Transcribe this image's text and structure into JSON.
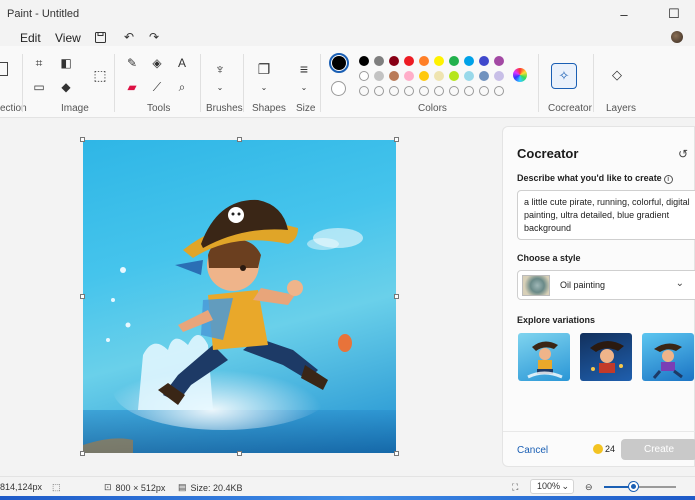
{
  "window": {
    "title": "Paint - Untitled"
  },
  "menu": {
    "edit": "Edit",
    "view": "View"
  },
  "ribbon": {
    "groups": {
      "selection": "ection",
      "image": "Image",
      "tools": "Tools",
      "brushes": "Brushes",
      "shapes": "Shapes",
      "size": "Size",
      "colors": "Colors",
      "cocreator": "Cocreator",
      "layers": "Layers"
    },
    "primary_color": "#000000",
    "secondary_color": "#ffffff",
    "palette_row1": [
      "#000000",
      "#7f7f7f",
      "#880015",
      "#ed1c24",
      "#ff7f27",
      "#fff200",
      "#22b14c",
      "#00a2e8",
      "#3f48cc",
      "#a349a4"
    ],
    "palette_row2": [
      "#ffffff",
      "#c3c3c3",
      "#b97a57",
      "#ffaec9",
      "#ffc90e",
      "#efe4b0",
      "#b5e61d",
      "#99d9ea",
      "#7092be",
      "#c8bfe7"
    ]
  },
  "panel": {
    "title": "Cocreator",
    "describe_label": "Describe what you'd like to create",
    "prompt": "a little cute pirate, running, colorful, digital painting, ultra detailed, blue gradient background",
    "style_label": "Choose a style",
    "style_value": "Oil painting",
    "variations_label": "Explore variations",
    "cancel": "Cancel",
    "credits": "24",
    "create": "Create"
  },
  "status": {
    "cursor": "814,124px",
    "canvas_size": "800 × 512px",
    "file_size": "Size: 20.4KB",
    "zoom": "100%",
    "zoom_level": 0.4
  }
}
